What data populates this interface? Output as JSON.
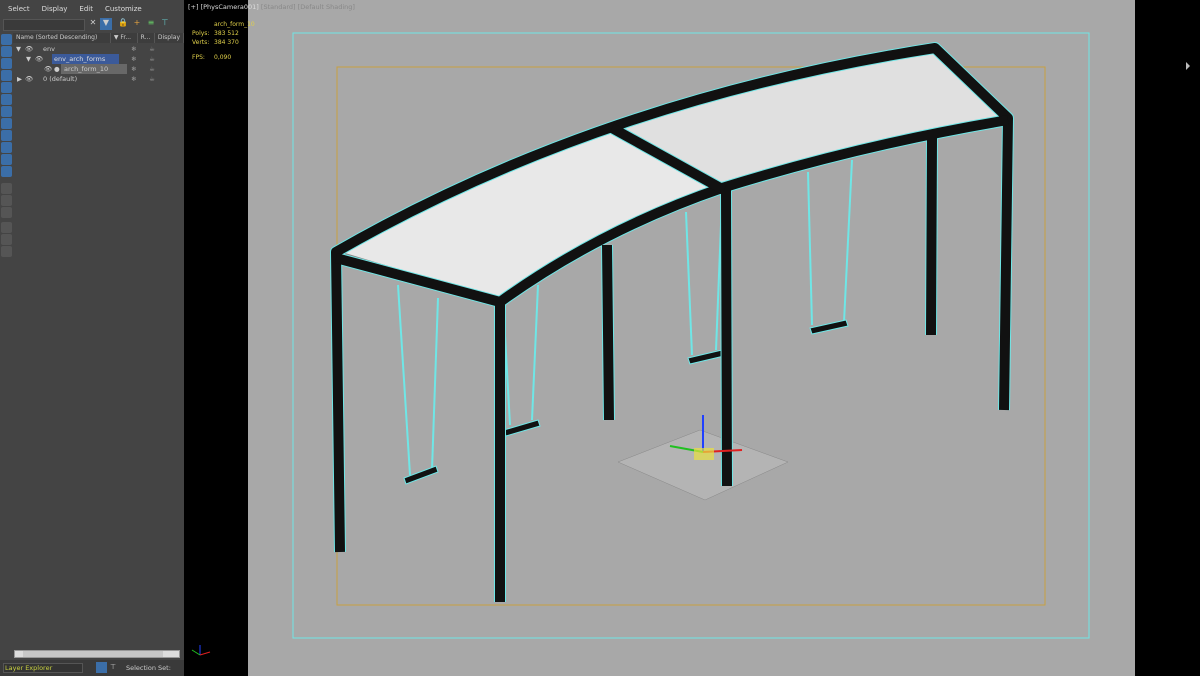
{
  "menu": [
    "Select",
    "Display",
    "Edit",
    "Customize"
  ],
  "explorer": {
    "columns": [
      "Name (Sorted Descending)",
      "▼ Fr...",
      "R...",
      "Display"
    ],
    "rows": [
      {
        "name": "env",
        "level": 0,
        "expanded": true
      },
      {
        "name": "env_arch_forms",
        "level": 1,
        "expanded": true,
        "selected": true
      },
      {
        "name": "arch_form_10",
        "level": 2,
        "highlight": true
      },
      {
        "name": "0 (default)",
        "level": 0,
        "expanded": false
      }
    ],
    "footer_label": "Layer Explorer",
    "selection_set_label": "Selection Set:"
  },
  "viewport": {
    "label_camera": "[+] [PhysCamera001]",
    "label_mode": "[Standard]",
    "label_shading": "[Default Shading]",
    "object": "arch_form_10",
    "polys_label": "Polys:",
    "polys": "383 512",
    "verts_label": "Verts:",
    "verts": "384 370",
    "fps_label": "FPS:",
    "fps": "0,090"
  },
  "colors": {
    "accent": "#3b6ea8",
    "wire": "#6fe6e6",
    "stats": "#e0d04a",
    "safe_frame": "#c8a040"
  }
}
